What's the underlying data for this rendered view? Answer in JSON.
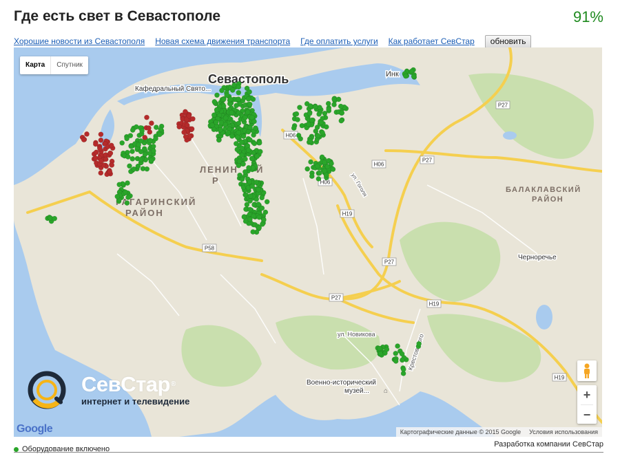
{
  "header": {
    "title": "Где есть свет в Севастополе",
    "percent": "91%"
  },
  "links": {
    "items": [
      "Хорошие новости из Севастополя",
      "Новая схема движения транспорта",
      "Где оплатить услуги",
      "Как работает СевСтар"
    ],
    "refresh_label": "обновить"
  },
  "map": {
    "type_active": "Карта",
    "type_inactive": "Спутник",
    "labels": {
      "city": "Севастополь",
      "cathedral": "Кафедральный Свято...",
      "lenin_1": "ЛЕНИН",
      "lenin_2": "Й",
      "lenin_3": "Р",
      "gagarin_1": "ГАГАРИНСКИЙ",
      "gagarin_2": "РАЙОН",
      "balaklava_1": "БАЛАКЛАВСКИЙ",
      "balaklava_2": "РАЙОН",
      "chernorechye": "Черноречье",
      "novikova": "ул. Новикова",
      "krestovskogo": "Крестовского",
      "museum_1": "Военно-исторический",
      "museum_2": "музей...",
      "inkerman": "Инк",
      "street_vert": "ул. Гоголя"
    },
    "roads": [
      "P27",
      "P27",
      "P27",
      "P27",
      "H06",
      "H06",
      "H06",
      "H19",
      "H19",
      "H19",
      "P58"
    ],
    "zoom_in": "+",
    "zoom_out": "−",
    "attribution_data": "Картографические данные © 2015 Google",
    "attribution_terms": "Условия использования",
    "google_logo": "Google",
    "colors": {
      "water": "#a9cbee",
      "land": "#e9e5d8",
      "park": "#c9dfae",
      "road_major": "#f9d86b",
      "power_on": "#2aa52a",
      "power_off": "#b52b2b"
    }
  },
  "brand": {
    "name": "СевСтар",
    "reg": "®",
    "tagline": "интернет и телевидение"
  },
  "footer": {
    "legend": "Оборудование включено",
    "credit": "Разработка компании СевСтар"
  }
}
